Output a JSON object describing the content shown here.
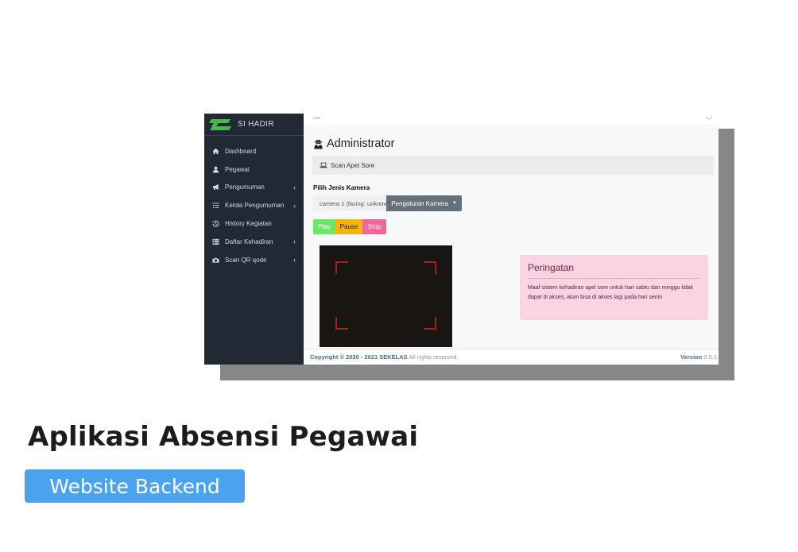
{
  "app": {
    "brand": "SI HADIR"
  },
  "sidebar": {
    "items": [
      {
        "label": "Dashboard",
        "icon": "home-icon",
        "chevron": ""
      },
      {
        "label": "Pegawai",
        "icon": "user-icon",
        "chevron": ""
      },
      {
        "label": "Pengumuman",
        "icon": "megaphone-icon",
        "chevron": "‹"
      },
      {
        "label": "Kelola Pengumuman",
        "icon": "tasks-icon",
        "chevron": "‹"
      },
      {
        "label": "History Kegiatan",
        "icon": "history-icon",
        "chevron": ""
      },
      {
        "label": "Daftar Kehadiran",
        "icon": "list-icon",
        "chevron": "‹"
      },
      {
        "label": "Scan QR qode",
        "icon": "camera-icon",
        "chevron": "‹"
      }
    ]
  },
  "main": {
    "title": "Administrator",
    "card_title": "Scan Apel Sore",
    "camera_label": "Pilih Jenis Kamera",
    "camera_select": "camera 1 (facing: unknown)",
    "camera_settings": "Pengaturan Kamera",
    "controls": {
      "play": "Play",
      "pause": "Pause",
      "stop": "Stop"
    }
  },
  "alert": {
    "title": "Peringatan",
    "body": "Maaf sistem kehadiran apel sore untuk hari sabtu dan minggu tidak dapat di akses, akan bisa di akses lagi pada hari senin"
  },
  "footer": {
    "copyright": "Copyright © 2020 - 2021 SEKELAS",
    "rights": " All rights reserved.",
    "version_label": "Version",
    "version_value": " 0.0.1"
  },
  "caption": {
    "headline": "Aplikasi Absensi Pegawai",
    "badge": "Website Backend"
  },
  "colors": {
    "sidebar_bg": "#212a34",
    "brand_green": "#49b749",
    "play": "#68e867",
    "pause": "#f8b40b",
    "stop": "#f2679a",
    "alert_bg": "#fbd4e3",
    "badge_bg": "#4aa3ec"
  }
}
